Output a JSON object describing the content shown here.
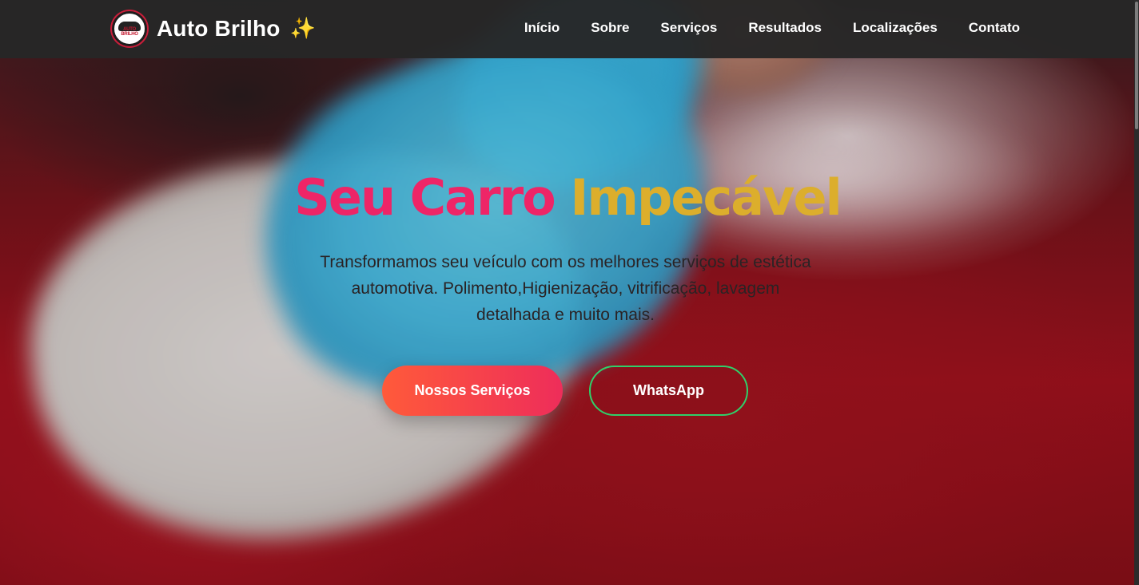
{
  "navbar": {
    "logo_text": "AUTO BRILHO",
    "brand_name": "Auto Brilho",
    "brand_emoji": "✨",
    "items": [
      {
        "label": "Início"
      },
      {
        "label": "Sobre"
      },
      {
        "label": "Serviços"
      },
      {
        "label": "Resultados"
      },
      {
        "label": "Localizações"
      },
      {
        "label": "Contato"
      }
    ]
  },
  "hero": {
    "title_part1": "Seu Carro",
    "title_part2": "Impecável",
    "subtitle": "Transformamos seu veículo com os melhores serviços de estética automotiva. Polimento,Higienização, vitrificação, lavagem detalhada e muito mais.",
    "primary_button": "Nossos Serviços",
    "secondary_button": "WhatsApp"
  },
  "colors": {
    "title_pink": "#ee2567",
    "title_gold": "#dcae2c",
    "button_gradient_start": "#ff5a3a",
    "button_gradient_end": "#ee2d5a",
    "whatsapp_border": "#2fd06a",
    "navbar_bg": "#262626"
  }
}
